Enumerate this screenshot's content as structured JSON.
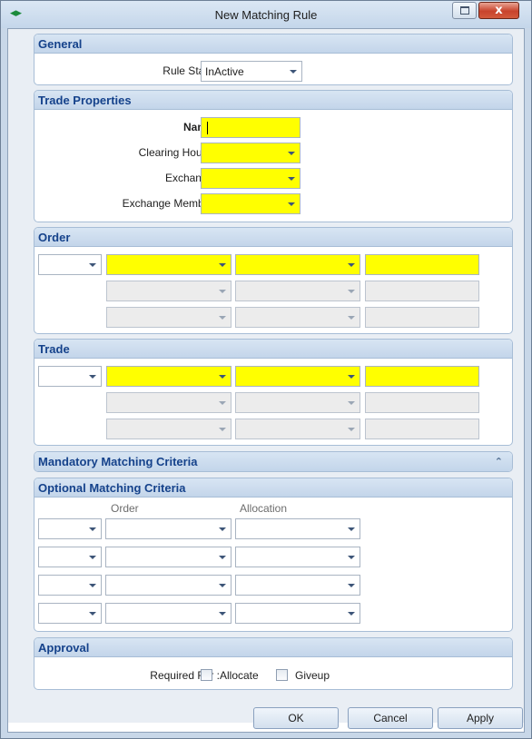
{
  "window": {
    "title": "New Matching Rule",
    "close_glyph": "x",
    "app_icon": "◆"
  },
  "general": {
    "header": "General",
    "rule_state_label": "Rule State :",
    "rule_state_value": "InActive"
  },
  "trade_properties": {
    "header": "Trade Properties",
    "name_label": "Name :",
    "name_value": "",
    "clearing_house_label": "Clearing House :",
    "exchange_label": "Exchange :",
    "exchange_member_label": "Exchange Member :"
  },
  "order": {
    "header": "Order"
  },
  "trade": {
    "header": "Trade"
  },
  "mandatory": {
    "header": "Mandatory Matching Criteria",
    "collapse_glyph": "⌃"
  },
  "optional": {
    "header": "Optional Matching Criteria",
    "col_order": "Order",
    "col_allocation": "Allocation"
  },
  "approval": {
    "header": "Approval",
    "required_for_label": "Required For :",
    "allocate_label": "Allocate",
    "giveup_label": "Giveup"
  },
  "buttons": {
    "ok": "OK",
    "cancel": "Cancel",
    "apply": "Apply"
  },
  "colors": {
    "required_field": "#ffff00",
    "section_header_text": "#15428b",
    "close_button": "#c8432b"
  }
}
